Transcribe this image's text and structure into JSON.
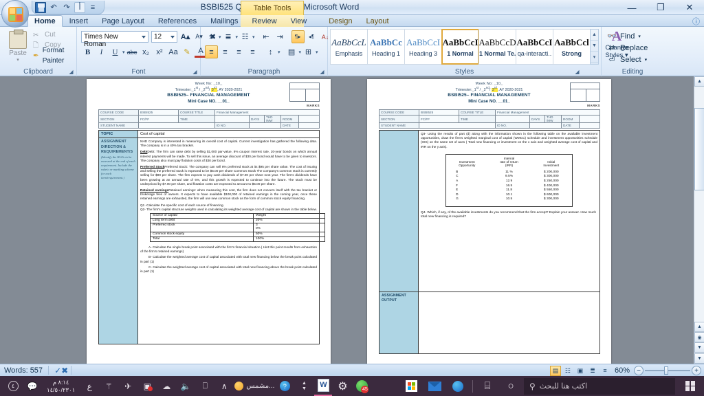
{
  "window": {
    "title": "BSBI525 QPMini Case (2) - Microsoft Word",
    "contextual_tab_group": "Table Tools",
    "minimize": "—",
    "restore": "❐",
    "close": "✕",
    "help": "?"
  },
  "quick_access": {
    "items": [
      {
        "name": "save-icon",
        "glyph": "💾"
      },
      {
        "name": "undo-icon",
        "glyph": "↶"
      },
      {
        "name": "redo-icon",
        "glyph": "↷"
      },
      {
        "name": "arabic-icon",
        "glyph": "أ"
      },
      {
        "name": "customize-qat-icon",
        "glyph": "☰"
      }
    ]
  },
  "ribbon_tabs": [
    {
      "label": "Home",
      "active": true
    },
    {
      "label": "Insert",
      "active": false
    },
    {
      "label": "Page Layout",
      "active": false
    },
    {
      "label": "References",
      "active": false
    },
    {
      "label": "Mailings",
      "active": false
    },
    {
      "label": "Review",
      "active": false
    },
    {
      "label": "View",
      "active": false
    },
    {
      "label": "Design",
      "active": false,
      "contextual": true
    },
    {
      "label": "Layout",
      "active": false,
      "contextual": true
    }
  ],
  "ribbon": {
    "clipboard": {
      "group_label": "Clipboard",
      "paste_label": "Paste",
      "cut_label": "Cut",
      "copy_label": "Copy",
      "format_painter_label": "Format Painter"
    },
    "font": {
      "group_label": "Font",
      "font_name": "Times New Roman",
      "font_size": "12",
      "grow_font": "A",
      "shrink_font": "A",
      "clear_formatting": "Aa",
      "bold": "B",
      "italic": "I",
      "underline": "U",
      "strikethrough": "abc",
      "subscript": "x₂",
      "superscript": "x²",
      "change_case": "Aa",
      "text_highlight": "✎",
      "font_color": "A"
    },
    "paragraph": {
      "group_label": "Paragraph",
      "bullets": "≡",
      "numbering": "≣",
      "multilevel": "☷",
      "decrease_indent": "⇤",
      "increase_indent": "⇥",
      "ltr": "¶▸",
      "rtl": "◂¶",
      "sort": "↓",
      "show_marks": "¶",
      "align_left": "≡",
      "align_center": "≡",
      "align_right": "≡",
      "justify": "≡",
      "line_spacing": "↕",
      "shading": "▤",
      "borders": "⊞"
    },
    "styles": {
      "group_label": "Styles",
      "gallery": [
        {
          "preview": "AaBbCcL",
          "name": "Emphasis",
          "selected": false
        },
        {
          "preview": "AaBbCc",
          "name": "Heading 1",
          "selected": false
        },
        {
          "preview": "AaBbCcI",
          "name": "Heading 3",
          "selected": false
        },
        {
          "preview": "AaBbCcI",
          "name": "1 Normal",
          "selected": true
        },
        {
          "preview": "AaBbCcD",
          "name": "1 Normal Te..",
          "selected": false
        },
        {
          "preview": "AaBbCcI",
          "name": "qa-interacti..",
          "selected": false
        },
        {
          "preview": "AaBbCcl",
          "name": "Strong",
          "selected": false
        }
      ],
      "change_styles_label": "Change Styles",
      "change_styles_preview": "A"
    },
    "editing": {
      "group_label": "Editing",
      "find_label": "Find",
      "replace_label": "Replace",
      "select_label": "Select"
    }
  },
  "document": {
    "header": {
      "week_line": "Week No: _10_",
      "trimester_pre": "Trimester:_1",
      "trimester_sup1": "st",
      "trimester_mid": " / _2",
      "trimester_sup2": "nd",
      "trimester_slash": "/ ",
      "trimester_hl": "3",
      "trimester_hl_sup": "rd",
      "trimester_post": ", AY 2020-2021",
      "course_title_line": "BSBI525– FINANCIAL MANAGEMENT",
      "case_line": "Mini Case NO. __01_",
      "marks_label": "MARKS"
    },
    "info_table": [
      [
        {
          "label": "COURSE CODE",
          "value": "BSBI525"
        },
        {
          "label": "COURSE TITLE",
          "value": "Financial Management"
        }
      ],
      [
        {
          "label": "SECTION",
          "value": "FC/FF"
        },
        {
          "label": "TIME",
          "value": ""
        },
        {
          "label": "DAYS",
          "value": ""
        },
        {
          "label": "THD /MW",
          "value": ""
        },
        {
          "label": "ROOM",
          "value": ""
        }
      ],
      [
        {
          "label": "STUDENT NAME",
          "value": ""
        },
        {
          "label": "ID NO.",
          "value": ""
        },
        {
          "label": "DATE",
          "value": ""
        }
      ]
    ],
    "left_page": {
      "topic_label": "TOPIC",
      "topic_value": "Cost of capital",
      "assignment_label": "ASSIGNMENT DIRECTION & REQUIREMENT/S",
      "assignment_note": "(Identify the KLOs to be assessed at the end of each requirement. Include the rubric or marking scheme for each item/requirement.)",
      "paragraphs": [
        "NHD Company is interested in measuring its overall cost of capital. Current investigation has gathered the following data. The company is in a 40% tax bracket.",
        "Debt: The firm can raise debt by selling $1,000 par-value, 8% coupon interest rate, 20-year bonds on which annual interest payments will be made. To sell this issue, an average discount of $30 per bond would have to be given to investors. The company also must pay flotation costs of $30 per bond.",
        "Preferred Stock: The company can sell 8% preferred stock at its $95 per share value. The cost of issuing and selling the preferred stock is expected to be $5.00 per share Common Stock The company's common stock is currently selling for $90 per share. The firm expects to pay cash dividends of $7.00 per share next year. The firm's dividends have been growing at an annual rate of 6%, and this growth is expected to continue into the future. The stock must be underpriced by $7.00 per share, and flotation costs are expected to amount to $5.00 per share.",
        "Retained earnings: when measuring this cost, the firm does not concern itself with the tax bracket or brokerage fees of owners. It expects to have available $100,000 of retained earnings in the coming year, once these retained earnings are exhausted, the firm will use new common stock as the form of common stock equity financing.",
        "Q1 -Calculate the specific cost of each source of financing.",
        "Q2- The firm's capital structure weights used in calculating its weighted average cost of capital are shown in the table below."
      ],
      "bold_leads": [
        "",
        "Debt",
        "Preferred Stock",
        "Retained earnings",
        "",
        ""
      ],
      "weights_table": {
        "headers": [
          "Source of capital",
          "Weight"
        ],
        "rows": [
          [
            "Long term debt",
            "20%"
          ],
          [
            "Preferred stock",
            "3\n0%"
          ],
          [
            "Common stock  equity",
            "50%"
          ],
          [
            "Total",
            "100%"
          ]
        ]
      },
      "sub_questions": [
        "A- Calculate the single break point associated with the firm's financial situation.( Hint this point results from exhaustion of the firm's retained earnings)",
        "B- Calculate the weighted average cost of capital associated with total new financing below  the break point calculated in part (1)",
        "C- Calculate the weighted average cost of capital associated with total new financing above the break point calculated in part (1)"
      ]
    },
    "right_page": {
      "q3_text": "Q3- Using the results of part (d) along with the information shown in the following table on the available investment opportunities, draw the firm's weighted marginal cost of capital (WMCC) schedule and investment opportunities schedule (IOS) on the same set of axes ( Total new financing or investment on the x axis and weighted average cost of capital and IRR on the y axis).",
      "investment_table": {
        "header_top": "Internal",
        "headers": [
          "Investment Opportunity",
          "rate of return (IRR)",
          "Initial investment"
        ],
        "col1_line1": "Investment",
        "col1_line2": "Opportunity",
        "col2_line1": "rate of return",
        "col2_line2": "(IRR)",
        "col3_line1": "Initial",
        "col3_line2": "Investment",
        "rows": [
          [
            "B",
            "11 %",
            "$ 200,000"
          ],
          [
            "C",
            "9.5%",
            "$ 300,000"
          ],
          [
            "A",
            "12.9",
            "$ 250,000"
          ],
          [
            "F",
            "16.5",
            "$ 400,000"
          ],
          [
            "E",
            "11.8",
            "$ 550,000"
          ],
          [
            "D",
            "10.1",
            "$ 600,000"
          ],
          [
            "G",
            "10.5",
            "$ 300,000"
          ]
        ]
      },
      "q4_text": "Q4- Which, if any, of the available investments do you recommend that the firm accept? Explain your answer. How much total new financing is required?",
      "assignment_output_label": "ASSIGNMENT OUTPUT"
    }
  },
  "status_bar": {
    "words_label": "Words: 557",
    "proofing_icon": "proofing-errors-icon",
    "zoom_level": "60%",
    "view_buttons": [
      {
        "name": "print-layout-view",
        "glyph": "▤",
        "selected": true
      },
      {
        "name": "full-screen-reading-view",
        "glyph": "☷",
        "selected": false
      },
      {
        "name": "web-layout-view",
        "glyph": "▣",
        "selected": false
      },
      {
        "name": "outline-view",
        "glyph": "≣",
        "selected": false
      },
      {
        "name": "draft-view",
        "glyph": "≡",
        "selected": false
      }
    ],
    "zoom_out": "−",
    "zoom_in": "+"
  },
  "taskbar": {
    "search_placeholder": "اكتب هنا للبحث",
    "items": [
      {
        "name": "task-view-icon",
        "glyph": "○"
      },
      {
        "name": "cortana-icon",
        "glyph": "⌸"
      },
      {
        "name": "edge-icon",
        "glyph": ""
      },
      {
        "name": "mail-icon",
        "glyph": ""
      },
      {
        "name": "store-icon",
        "glyph": ""
      },
      {
        "name": "word-icon",
        "glyph": "W"
      },
      {
        "name": "settings-icon",
        "glyph": "⚙"
      },
      {
        "name": "whatsapp-icon",
        "glyph": "",
        "badge": "45"
      },
      {
        "name": "help-icon",
        "glyph": "?"
      }
    ],
    "tray": [
      {
        "name": "show-hidden-icons",
        "glyph": "∧"
      },
      {
        "name": "screen-record-icon",
        "glyph": "□"
      },
      {
        "name": "volume-icon",
        "glyph": "🔊"
      },
      {
        "name": "onedrive-icon",
        "glyph": "☁"
      },
      {
        "name": "screenshot-icon",
        "glyph": "▣"
      },
      {
        "name": "airplane-icon",
        "glyph": "✈"
      },
      {
        "name": "network-icon",
        "glyph": "🖧"
      },
      {
        "name": "battery-icon",
        "glyph": "ε"
      }
    ],
    "weather_text": "مشمس...",
    "clock_time": "٨:١٤ م",
    "clock_date": "١٤/٥٠/٢٣٠١",
    "battery_label": "٤"
  }
}
